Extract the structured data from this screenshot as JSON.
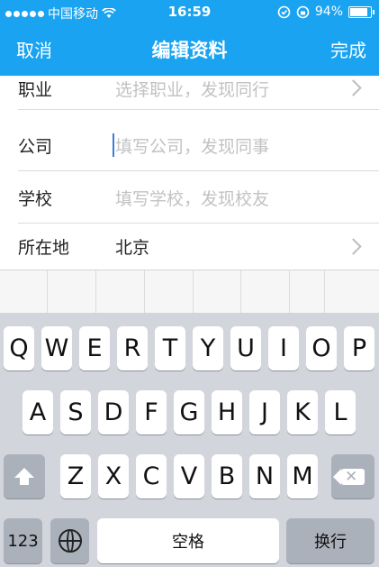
{
  "status_bar": {
    "carrier": "中国移动",
    "time": "16:59",
    "battery": "94%"
  },
  "nav": {
    "cancel": "取消",
    "title": "编辑资料",
    "done": "完成"
  },
  "form": {
    "rows": [
      {
        "label": "职业",
        "placeholder": "选择职业，发现同行",
        "value": ""
      },
      {
        "label": "公司",
        "placeholder": "填写公司，发现同事",
        "value": ""
      },
      {
        "label": "学校",
        "placeholder": "填写学校，发现校友",
        "value": ""
      },
      {
        "label": "所在地",
        "placeholder": "",
        "value": "北京"
      }
    ]
  },
  "keyboard": {
    "row1": [
      "Q",
      "W",
      "E",
      "R",
      "T",
      "Y",
      "U",
      "I",
      "O",
      "P"
    ],
    "row2": [
      "A",
      "S",
      "D",
      "F",
      "G",
      "H",
      "J",
      "K",
      "L"
    ],
    "row3": [
      "Z",
      "X",
      "C",
      "V",
      "B",
      "N",
      "M"
    ],
    "numbers": "123",
    "space": "空格",
    "return": "换行"
  }
}
